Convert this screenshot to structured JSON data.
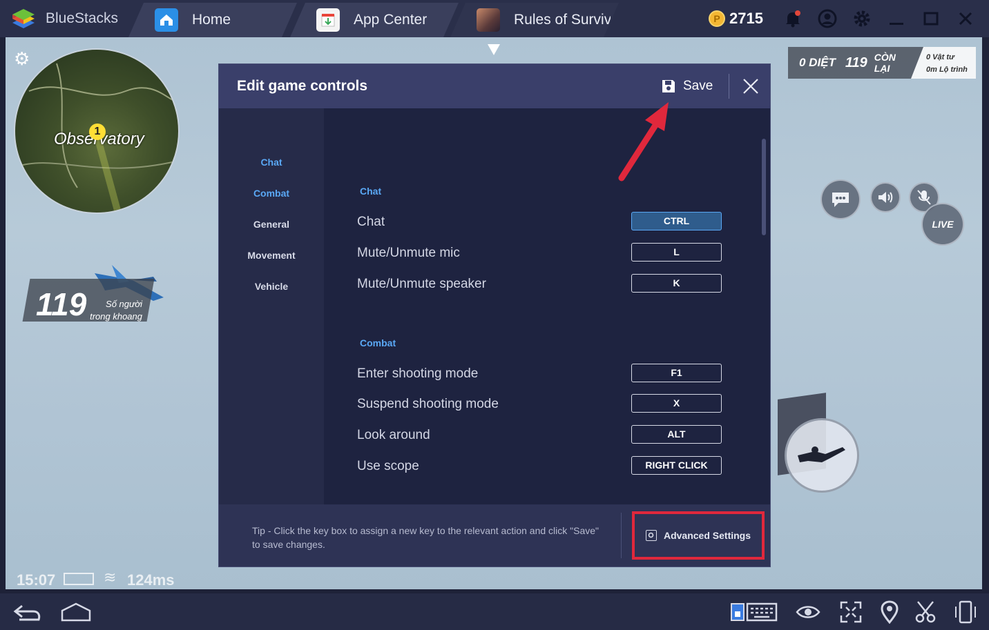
{
  "app": {
    "name": "BlueStacks",
    "tabs": [
      {
        "label": "Home",
        "icon": "home-icon"
      },
      {
        "label": "App Center",
        "icon": "app-center-icon"
      },
      {
        "label": "Rules of Surviva",
        "icon": "game-thumbnail"
      }
    ],
    "coins": "2715"
  },
  "game_hud": {
    "minimap_location": "Observatory",
    "minimap_marker": "1",
    "players_left": "119",
    "players_left_label_line1": "Số người",
    "players_left_label_line2": "trong khoang",
    "kills": "0 DIỆT",
    "remaining": "119",
    "remaining_label": "CÒN LẠI",
    "supplies_line1": "0 Vật tư",
    "supplies_line2": "0m Lộ trình",
    "live_badge": "LIVE",
    "time": "15:07",
    "ping": "124ms"
  },
  "dialog": {
    "title": "Edit game controls",
    "save_label": "Save",
    "sidebar": [
      "Chat",
      "Combat",
      "General",
      "Movement",
      "Vehicle"
    ],
    "sections": [
      {
        "title": "Chat",
        "rows": [
          {
            "label": "Chat",
            "key": "CTRL"
          },
          {
            "label": "Mute/Unmute mic",
            "key": "L"
          },
          {
            "label": "Mute/Unmute speaker",
            "key": "K"
          }
        ]
      },
      {
        "title": "Combat",
        "rows": [
          {
            "label": "Enter shooting mode",
            "key": "F1"
          },
          {
            "label": "Suspend shooting mode",
            "key": "X"
          },
          {
            "label": "Look around",
            "key": "ALT"
          },
          {
            "label": "Use scope",
            "key": "RIGHT CLICK"
          }
        ]
      }
    ],
    "tip": "Tip - Click the key box to assign a new key to the relevant action and click \"Save\" to save changes.",
    "advanced_settings_label": "Advanced Settings"
  },
  "colors": {
    "accent_blue": "#5aa8f5",
    "highlight_red": "#e0283c",
    "coin_gold": "#f4b733"
  }
}
